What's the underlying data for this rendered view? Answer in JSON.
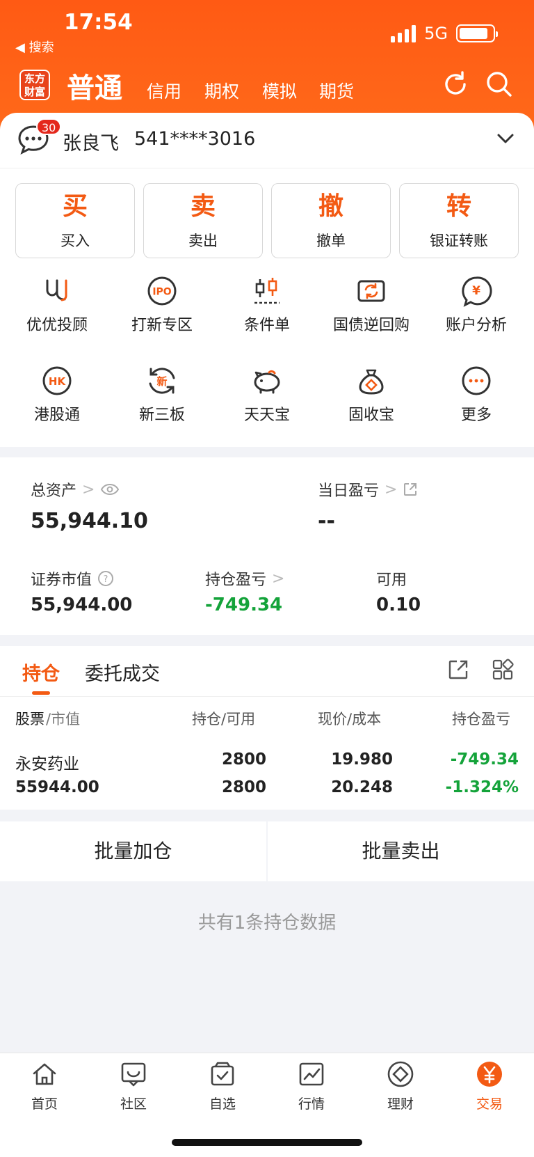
{
  "status": {
    "time": "17:54",
    "back_label": "◀ 搜索",
    "network": "5G",
    "battery_level": 0.88
  },
  "nav": {
    "logo_text": "东方财富",
    "main_tab": "普通",
    "tabs": [
      "信用",
      "期权",
      "模拟",
      "期货"
    ]
  },
  "account": {
    "badge": "30",
    "name": "张良飞",
    "number": "541****3016"
  },
  "trade_buttons": [
    {
      "big": "买",
      "small": "买入"
    },
    {
      "big": "卖",
      "small": "卖出"
    },
    {
      "big": "撤",
      "small": "撤单"
    },
    {
      "big": "转",
      "small": "银证转账"
    }
  ],
  "grid_items": [
    {
      "label": "优优投顾",
      "icon": "uu-advisor-icon"
    },
    {
      "label": "打新专区",
      "icon": "ipo-icon"
    },
    {
      "label": "条件单",
      "icon": "candlestick-icon"
    },
    {
      "label": "国债逆回购",
      "icon": "repo-icon"
    },
    {
      "label": "账户分析",
      "icon": "account-analysis-icon"
    },
    {
      "label": "港股通",
      "icon": "hk-icon"
    },
    {
      "label": "新三板",
      "icon": "new-board-icon"
    },
    {
      "label": "天天宝",
      "icon": "piggy-bank-icon"
    },
    {
      "label": "固收宝",
      "icon": "money-bag-icon"
    },
    {
      "label": "更多",
      "icon": "more-icon"
    }
  ],
  "assets": {
    "total_label": "总资产",
    "total_value": "55,944.10",
    "daily_label": "当日盈亏",
    "daily_value": "--",
    "market_label": "证券市值",
    "market_value": "55,944.00",
    "position_pl_label": "持仓盈亏",
    "position_pl_value": "-749.34",
    "available_label": "可用",
    "available_value": "0.10"
  },
  "positions": {
    "tabs": [
      "持仓",
      "委托成交"
    ],
    "headers": [
      "股票",
      "/市值",
      "持仓",
      "/可用",
      "现价",
      "/成本",
      "持仓盈亏"
    ],
    "rows": [
      {
        "name": "永安药业",
        "market_value": "55944.00",
        "holding": "2800",
        "available": "2800",
        "price": "19.980",
        "cost": "20.248",
        "pl": "-749.34",
        "pl_pct": "-1.324%"
      }
    ]
  },
  "batch": {
    "add": "批量加仓",
    "sell": "批量卖出"
  },
  "empty_msg": "共有1条持仓数据",
  "tabbar": [
    {
      "label": "首页",
      "icon": "home-icon"
    },
    {
      "label": "社区",
      "icon": "community-icon"
    },
    {
      "label": "自选",
      "icon": "watchlist-icon"
    },
    {
      "label": "行情",
      "icon": "market-icon"
    },
    {
      "label": "理财",
      "icon": "finance-icon"
    },
    {
      "label": "交易",
      "icon": "trade-icon"
    }
  ],
  "colors": {
    "brand": "#ff5a14",
    "accent": "#f35a13",
    "gain_loss_green": "#14a33a"
  }
}
